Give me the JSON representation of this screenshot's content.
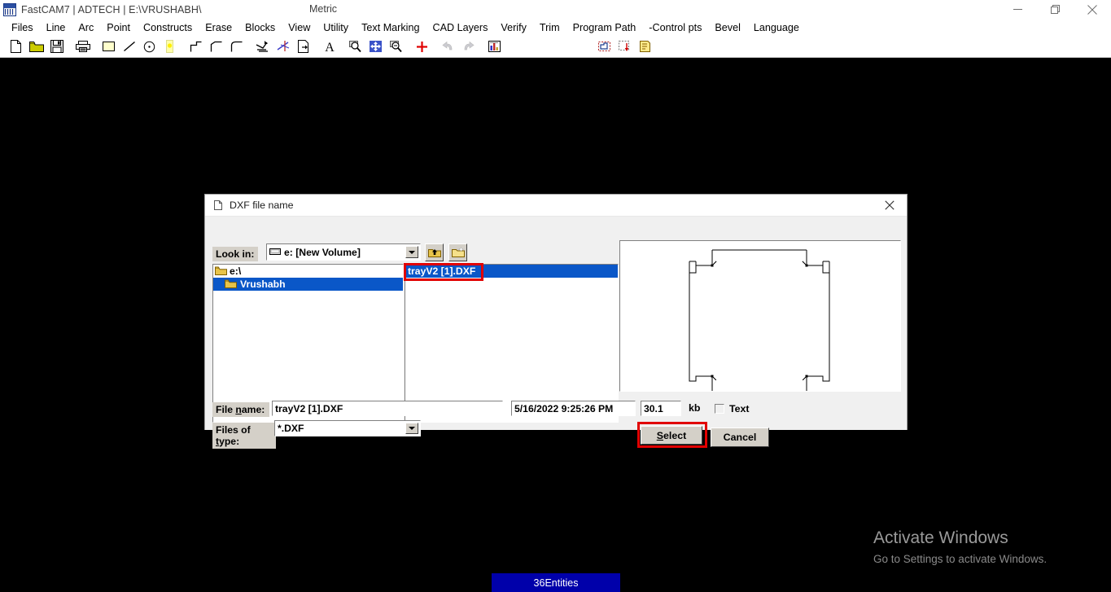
{
  "window": {
    "title": "FastCAM7 |  ADTECH  |  E:\\VRUSHABH\\",
    "units": "Metric",
    "app_icon": "fastcam-logo-icon",
    "controls": {
      "minimize": "minimize-icon",
      "restore": "restore-icon",
      "close": "close-icon"
    }
  },
  "menubar": {
    "items": [
      {
        "label": "Files"
      },
      {
        "label": "Line"
      },
      {
        "label": "Arc"
      },
      {
        "label": "Point"
      },
      {
        "label": "Constructs"
      },
      {
        "label": "Erase"
      },
      {
        "label": "Blocks"
      },
      {
        "label": "View"
      },
      {
        "label": "Utility"
      },
      {
        "label": "Text Marking"
      },
      {
        "label": "CAD Layers"
      },
      {
        "label": "Verify"
      },
      {
        "label": "Trim"
      },
      {
        "label": "Program Path"
      },
      {
        "label": "-Control pts"
      },
      {
        "label": "Bevel"
      },
      {
        "label": "Language"
      }
    ]
  },
  "toolbar": {
    "buttons": [
      {
        "name": "new-file-icon",
        "title": "New"
      },
      {
        "name": "open-folder-icon",
        "title": "Open"
      },
      {
        "name": "save-disk-icon",
        "title": "Save"
      },
      {
        "name": "print-icon",
        "title": "Print"
      },
      {
        "name": "rectangle-icon",
        "title": "Rectangle"
      },
      {
        "name": "line-icon",
        "title": "Line"
      },
      {
        "name": "circle-icon",
        "title": "Circle"
      },
      {
        "name": "point-icon",
        "title": "Point"
      },
      {
        "name": "step-corner-icon",
        "title": "Step"
      },
      {
        "name": "chamfer-icon",
        "title": "Chamfer"
      },
      {
        "name": "fillet-icon",
        "title": "Fillet"
      },
      {
        "name": "lead-in-icon",
        "title": "Lead in"
      },
      {
        "name": "trim-icon",
        "title": "Trim"
      },
      {
        "name": "export-icon",
        "title": "Export"
      },
      {
        "name": "text-icon",
        "title": "Text"
      },
      {
        "name": "zoom-window-icon",
        "title": "Zoom window"
      },
      {
        "name": "pan-icon",
        "title": "Pan"
      },
      {
        "name": "zoom-extents-icon",
        "title": "Zoom extents"
      },
      {
        "name": "crosshair-icon",
        "title": "Crosshair"
      },
      {
        "name": "undo-icon",
        "title": "Undo",
        "disabled": true
      },
      {
        "name": "redo-icon",
        "title": "Redo",
        "disabled": true
      },
      {
        "name": "chart-icon",
        "title": "Report"
      },
      {
        "name": "nest-icon",
        "title": "Nest"
      },
      {
        "name": "plate-icon",
        "title": "Plate"
      },
      {
        "name": "cut-path-icon",
        "title": "Cut path"
      }
    ]
  },
  "dialog": {
    "title": "DXF file name",
    "title_icon": "document-icon",
    "close_icon": "close-icon",
    "look_in": {
      "label": "Look in:",
      "value": "e: [New Volume]",
      "drive_icon": "drive-icon",
      "dropdown_icon": "chevron-down-icon",
      "up_folder_icon": "up-one-level-icon",
      "new_folder_icon": "new-folder-icon"
    },
    "tree": {
      "items": [
        {
          "label": "e:\\",
          "icon": "open-folder-icon",
          "selected": false,
          "indent": 0
        },
        {
          "label": "Vrushabh",
          "icon": "folder-icon",
          "selected": true,
          "indent": 1
        }
      ]
    },
    "files": {
      "items": [
        {
          "label": "trayV2 [1].DXF",
          "selected": true,
          "highlighted": true
        }
      ]
    },
    "preview": {
      "name": "dxf-preview",
      "shape": "tray-outline-with-notched-corners"
    },
    "file_name": {
      "label": "File name:",
      "label_accel": "n",
      "value": "trayV2 [1].DXF",
      "placeholder": ""
    },
    "file_date": {
      "value": "5/16/2022 9:25:26 PM"
    },
    "file_size": {
      "value": "30.1",
      "unit": "kb"
    },
    "text_checkbox": {
      "label": "Text",
      "checked": false
    },
    "files_of_type": {
      "label": "Files of type:",
      "label_accel": "t",
      "value": "*.DXF",
      "options": [
        "*.DXF"
      ]
    },
    "buttons": {
      "select": {
        "label": "Select",
        "accel": "S",
        "highlighted": true
      },
      "cancel": {
        "label": "Cancel"
      }
    }
  },
  "statusbar": {
    "text": "36Entities"
  },
  "watermark": {
    "title": "Activate Windows",
    "subtitle": "Go to Settings to activate Windows."
  },
  "colors": {
    "canvas": "#000000",
    "dialog_face": "#f0f0f0",
    "classic_face": "#d4d0c8",
    "selection_blue": "#0a57c8",
    "highlight_red": "#e10000",
    "status_blue": "#0000aa"
  }
}
